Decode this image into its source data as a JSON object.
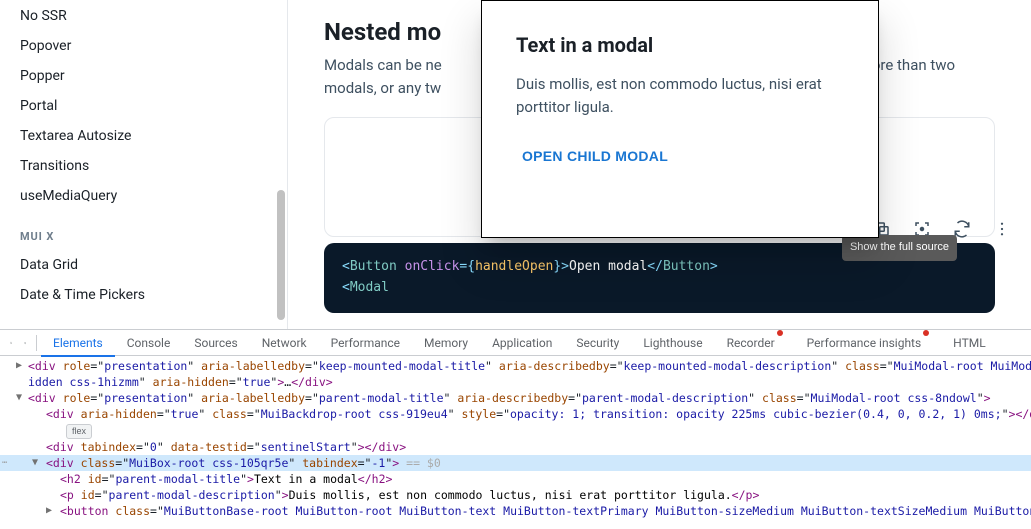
{
  "sidebar": {
    "items": [
      "No SSR",
      "Popover",
      "Popper",
      "Portal",
      "Textarea Autosize",
      "Transitions",
      "useMediaQuery"
    ],
    "section": "MUI X",
    "section_items": [
      "Data Grid",
      "Date & Time Pickers"
    ]
  },
  "page": {
    "title": "Nested mo",
    "desc_left": "Modals can be ne",
    "desc_right": "of more than two modals, or any tw"
  },
  "modal": {
    "title": "Text in a modal",
    "desc": "Duis mollis, est non commodo luctus, nisi erat porttitor ligula.",
    "button": "OPEN CHILD MODAL"
  },
  "code": {
    "tooltip": "Show the full source",
    "l1_tag": "Button",
    "l1_attr": "onClick",
    "l1_fn": "handleOpen",
    "l1_txt": "Open modal",
    "l2_tag": "Modal"
  },
  "devtools": {
    "tabs": [
      "Elements",
      "Console",
      "Sources",
      "Network",
      "Performance",
      "Memory",
      "Application",
      "Security",
      "Lighthouse",
      "Recorder",
      "Performance insights",
      "HTML"
    ],
    "badge": "flex",
    "eq0": " == $0",
    "dom": {
      "line1_a": "<div role=\"presentation\" aria-labelledby=\"keep-mounted-modal-title\" aria-describedby=\"keep-mounted-modal-description\" class=\"MuiModal-root MuiModal-h",
      "line1_b": "idden css-1hizmm\" aria-hidden=\"true\">…</div>",
      "line2": "<div role=\"presentation\" aria-labelledby=\"parent-modal-title\" aria-describedby=\"parent-modal-description\" class=\"MuiModal-root css-8ndowl\">",
      "line3": "<div aria-hidden=\"true\" class=\"MuiBackdrop-root css-919eu4\" style=\"opacity: 1; transition: opacity 225ms cubic-bezier(0.4, 0, 0.2, 1) 0ms;\"></div>",
      "line4": "<div tabindex=\"0\" data-testid=\"sentinelStart\"></div>",
      "line5": "<div class=\"MuiBox-root css-105qr5e\" tabindex=\"-1\">",
      "line6_a": "<h2 id=\"parent-modal-title\">",
      "line6_txt": "Text in a modal",
      "line6_b": "</h2>",
      "line7_a": "<p id=\"parent-modal-description\">",
      "line7_txt": "Duis mollis, est non commodo luctus, nisi erat porttitor ligula.",
      "line7_b": "</p>",
      "line8": "<button class=\"MuiButtonBase-root MuiButton-root MuiButton-text MuiButton-textPrimary MuiButton-sizeMedium MuiButton-textSizeMedium MuiButton-roo"
    }
  }
}
